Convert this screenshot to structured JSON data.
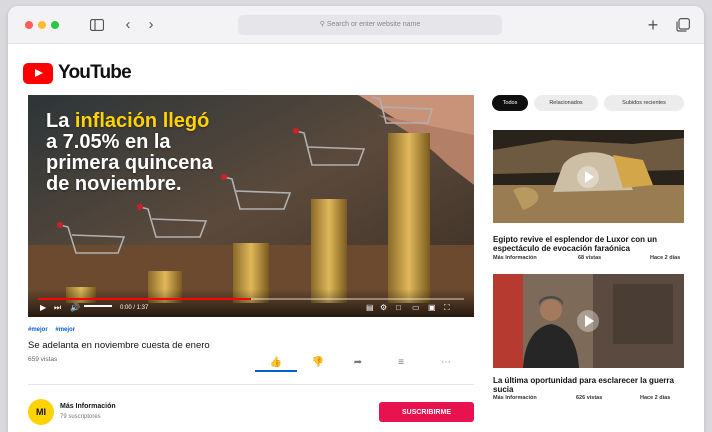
{
  "browser": {
    "url_placeholder": "Search or enter website name",
    "new_tab_glyph": "+",
    "back_glyph": "‹",
    "forward_glyph": "›"
  },
  "site": {
    "logo_text": "YouTube",
    "brand_color": "#ff0000"
  },
  "player": {
    "headline_prefix": "La ",
    "headline_highlight": "inflación llegó",
    "headline_line2": "a 7.05% en la",
    "headline_line3": "primera quincena",
    "headline_line4": "de noviembre.",
    "time_display": "0:00 / 1:37",
    "progress_fraction": 0.5
  },
  "video": {
    "tags": [
      "#mejor",
      "#mejor"
    ],
    "title": "Se adelanta en noviembre cuesta de enero",
    "views": "659 vistas"
  },
  "channel": {
    "avatar_text": "MI",
    "name": "Más Información",
    "subscribers": "79 suscriptores",
    "subscribe_label": "SUSCRIBIRME"
  },
  "sidebar": {
    "chips": [
      {
        "label": "Todos",
        "active": true
      },
      {
        "label": "Relacionados",
        "active": false
      },
      {
        "label": "Subidos recientes",
        "active": false
      }
    ],
    "videos": [
      {
        "title": "Egipto revive el esplendor de Luxor con un espectáculo de evocación faraónica",
        "channel": "Más Información",
        "views": "68 vistas",
        "age": "Hace 2 días"
      },
      {
        "title": "La última oportunidad para esclarecer la guerra sucia",
        "channel": "Más Información",
        "views": "626 vistas",
        "age": "Hace 2 días"
      }
    ]
  },
  "colors": {
    "accent_blue": "#065fd4",
    "subscribe_red": "#e8124f",
    "highlight_yellow": "#ffd200"
  }
}
